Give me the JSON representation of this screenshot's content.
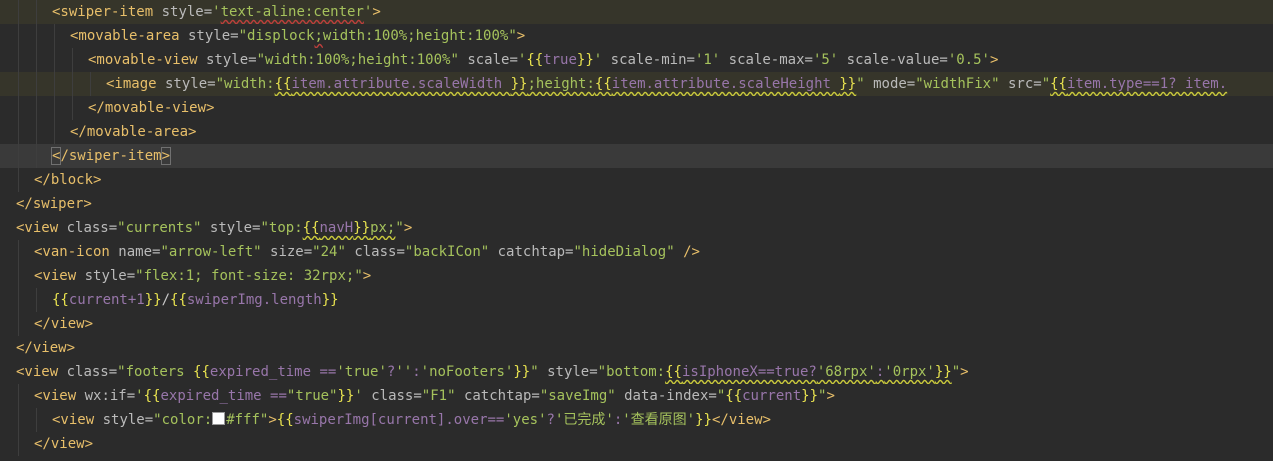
{
  "editor": {
    "lines": [
      {
        "indent": 3,
        "hl": "yellow",
        "tokens": [
          [
            "t",
            "<swiper-item"
          ],
          [
            "a",
            " style="
          ],
          [
            "s",
            "'"
          ],
          [
            "s|err",
            "text-aline:center"
          ],
          [
            "s",
            "'"
          ],
          [
            "t",
            ">"
          ]
        ]
      },
      {
        "indent": 4,
        "tokens": [
          [
            "t",
            "<movable-area"
          ],
          [
            "a",
            " style="
          ],
          [
            "s",
            "\"displock"
          ],
          [
            "s|err",
            ";"
          ],
          [
            "s",
            "width:100%;height:100%\""
          ],
          [
            "t",
            ">"
          ]
        ]
      },
      {
        "indent": 5,
        "tokens": [
          [
            "t",
            "<movable-view"
          ],
          [
            "a",
            " style="
          ],
          [
            "s",
            "\"width:100%;height:100%\""
          ],
          [
            "a",
            " scale="
          ],
          [
            "s",
            "'"
          ],
          [
            "b",
            "{{"
          ],
          [
            "v",
            "true"
          ],
          [
            "b",
            "}}"
          ],
          [
            "s",
            "'"
          ],
          [
            "a",
            " scale-min="
          ],
          [
            "s",
            "'1'"
          ],
          [
            "a",
            " scale-max="
          ],
          [
            "s",
            "'5'"
          ],
          [
            "a",
            " scale-value="
          ],
          [
            "s",
            "'0.5'"
          ],
          [
            "t",
            ">"
          ]
        ]
      },
      {
        "indent": 6,
        "hl": "yellow",
        "tokens": [
          [
            "t",
            "<image"
          ],
          [
            "a",
            " style="
          ],
          [
            "s",
            "\"width:"
          ],
          [
            "b|sq",
            "{{"
          ],
          [
            "v|sq",
            "item.attribute.scaleWidth "
          ],
          [
            "b|sq",
            "}}"
          ],
          [
            "s|sq",
            ";height:"
          ],
          [
            "b|sq",
            "{{"
          ],
          [
            "v|sq",
            "item.attribute.scaleHeight "
          ],
          [
            "b|sq",
            "}}"
          ],
          [
            "s",
            "\""
          ],
          [
            "a",
            " mode="
          ],
          [
            "s",
            "\"widthFix\""
          ],
          [
            "a",
            " src="
          ],
          [
            "s",
            "\""
          ],
          [
            "b|sq",
            "{{"
          ],
          [
            "v|sq",
            "item.type==1? item."
          ]
        ]
      },
      {
        "indent": 5,
        "tokens": [
          [
            "t",
            "</movable-view>"
          ]
        ]
      },
      {
        "indent": 4,
        "tokens": [
          [
            "t",
            "</movable-area>"
          ]
        ]
      },
      {
        "indent": 3,
        "hl": "cur",
        "tokens": [
          [
            "t|match",
            "<"
          ],
          [
            "t",
            "/swiper-item"
          ],
          [
            "t|match",
            ">"
          ]
        ]
      },
      {
        "indent": 2,
        "tokens": [
          [
            "t",
            "</block>"
          ]
        ]
      },
      {
        "indent": 1,
        "tokens": [
          [
            "t",
            "</swiper>"
          ]
        ]
      },
      {
        "indent": 1,
        "tokens": [
          [
            "t",
            "<view"
          ],
          [
            "a",
            " class="
          ],
          [
            "s",
            "\"currents\""
          ],
          [
            "a",
            " style="
          ],
          [
            "s",
            "\"top:"
          ],
          [
            "b|sq",
            "{{"
          ],
          [
            "v|sq",
            "navH"
          ],
          [
            "b|sq",
            "}}"
          ],
          [
            "s|sq",
            "px;"
          ],
          [
            "s",
            "\""
          ],
          [
            "t",
            ">"
          ]
        ]
      },
      {
        "indent": 2,
        "tokens": [
          [
            "t",
            "<van-icon"
          ],
          [
            "a",
            " name="
          ],
          [
            "s",
            "\"arrow-left\""
          ],
          [
            "a",
            " size="
          ],
          [
            "s",
            "\"24\""
          ],
          [
            "a",
            " class="
          ],
          [
            "s",
            "\"backICon\""
          ],
          [
            "a",
            " catchtap="
          ],
          [
            "s",
            "\"hideDialog\""
          ],
          [
            "t",
            " />"
          ]
        ]
      },
      {
        "indent": 2,
        "tokens": [
          [
            "t",
            "<view"
          ],
          [
            "a",
            " style="
          ],
          [
            "s",
            "\"flex:1; font-size: 32rpx;\""
          ],
          [
            "t",
            ">"
          ]
        ]
      },
      {
        "indent": 3,
        "tokens": [
          [
            "b",
            "{{"
          ],
          [
            "v",
            "current+1"
          ],
          [
            "b",
            "}}"
          ],
          [
            "w",
            "/"
          ],
          [
            "b",
            "{{"
          ],
          [
            "v",
            "swiperImg.length"
          ],
          [
            "b",
            "}}"
          ]
        ]
      },
      {
        "indent": 2,
        "tokens": [
          [
            "t",
            "</view>"
          ]
        ]
      },
      {
        "indent": 1,
        "tokens": [
          [
            "t",
            "</view>"
          ]
        ]
      },
      {
        "indent": 1,
        "tokens": [
          [
            "t",
            "<view"
          ],
          [
            "a",
            " class="
          ],
          [
            "s",
            "\"footers "
          ],
          [
            "b",
            "{{"
          ],
          [
            "v",
            "expired_time =="
          ],
          [
            "s",
            "'true'"
          ],
          [
            "v",
            "?"
          ],
          [
            "s",
            "''"
          ],
          [
            "v",
            ":"
          ],
          [
            "s",
            "'noFooters'"
          ],
          [
            "b",
            "}}"
          ],
          [
            "s",
            "\""
          ],
          [
            "a",
            " style="
          ],
          [
            "s",
            "\"bottom:"
          ],
          [
            "b|sq",
            "{{"
          ],
          [
            "v|sq",
            "isIphoneX==true?"
          ],
          [
            "s|sq",
            "'68rpx'"
          ],
          [
            "v|sq",
            ":"
          ],
          [
            "s|sq",
            "'0rpx'"
          ],
          [
            "b|sq",
            "}}"
          ],
          [
            "s",
            "\""
          ],
          [
            "t",
            ">"
          ]
        ]
      },
      {
        "indent": 2,
        "tokens": [
          [
            "t",
            "<view"
          ],
          [
            "a",
            " wx:if="
          ],
          [
            "s",
            "'"
          ],
          [
            "b",
            "{{"
          ],
          [
            "v",
            "expired_time =="
          ],
          [
            "s",
            "\"true\""
          ],
          [
            "b",
            "}}"
          ],
          [
            "s",
            "'"
          ],
          [
            "a",
            " class="
          ],
          [
            "s",
            "\"F1\""
          ],
          [
            "a",
            " catchtap="
          ],
          [
            "s",
            "\"saveImg\""
          ],
          [
            "a",
            " data-index="
          ],
          [
            "s",
            "\""
          ],
          [
            "b",
            "{{"
          ],
          [
            "v",
            "current"
          ],
          [
            "b",
            "}}"
          ],
          [
            "s",
            "\""
          ],
          [
            "t",
            ">"
          ]
        ]
      },
      {
        "indent": 3,
        "tokens": [
          [
            "t",
            "<view"
          ],
          [
            "a",
            " style="
          ],
          [
            "s",
            "\"color:"
          ],
          [
            "swatch",
            ""
          ],
          [
            "s",
            "#fff\""
          ],
          [
            "t",
            ">"
          ],
          [
            "b",
            "{{"
          ],
          [
            "v",
            "swiperImg[current].over=="
          ],
          [
            "s",
            "'yes'"
          ],
          [
            "v",
            "?"
          ],
          [
            "s",
            "'已完成'"
          ],
          [
            "v",
            ":"
          ],
          [
            "s",
            "'查看原图'"
          ],
          [
            "b",
            "}}"
          ],
          [
            "t",
            "</view>"
          ]
        ]
      },
      {
        "indent": 2,
        "tokens": [
          [
            "t",
            "</view>"
          ]
        ]
      }
    ]
  }
}
